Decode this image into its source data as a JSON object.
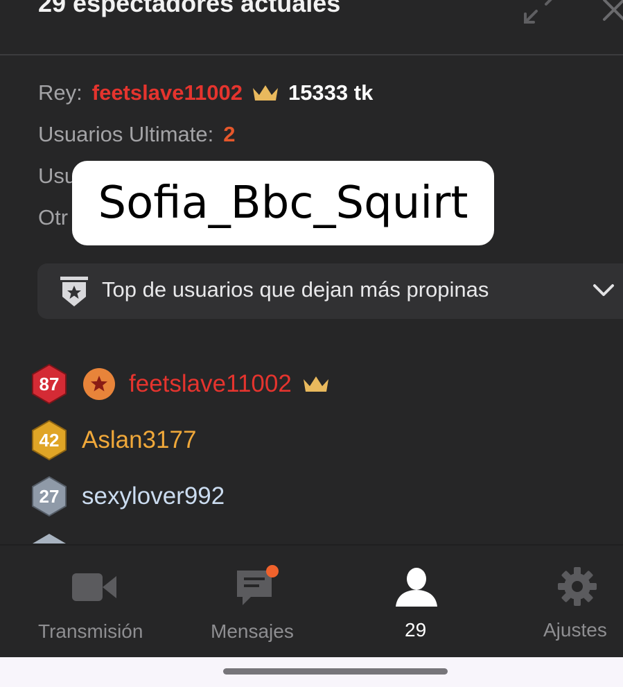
{
  "header": {
    "title": "29 espectadores actuales",
    "expand_icon": "expand-icon",
    "close_icon": "close-icon"
  },
  "info": {
    "king_label": "Rey:",
    "king_name": "feetslave11002",
    "king_tokens": "15333 tk",
    "ultimate_label": "Usuarios Ultimate:",
    "ultimate_count": "2",
    "partial_line3": "Usu",
    "partial_line4": "Otr"
  },
  "overlay": {
    "text": "Sofia_Bbc_Squirt"
  },
  "top_tippers": {
    "label": "Top de usuarios que dejan más propinas",
    "icon": "shield-star-icon",
    "chevron": "chevron-down-icon"
  },
  "users": [
    {
      "level": "87",
      "name": "feetslave11002",
      "name_color": "#e5342e",
      "badge_color": "#d42b35",
      "has_star": true,
      "has_crown": true
    },
    {
      "level": "42",
      "name": "Aslan3177",
      "name_color": "#f0a83a",
      "badge_color": "#e0a526",
      "has_star": false,
      "has_crown": false
    },
    {
      "level": "27",
      "name": "sexylover992",
      "name_color": "#cbdcf0",
      "badge_color": "#8f9aa8",
      "has_star": false,
      "has_crown": false
    }
  ],
  "bottom_nav": {
    "items": [
      {
        "label": "Transmisión",
        "icon": "video-camera-icon"
      },
      {
        "label": "Mensajes",
        "icon": "chat-icon"
      },
      {
        "label": "29",
        "icon": "user-icon"
      },
      {
        "label": "Ajustes",
        "icon": "gear-icon"
      }
    ]
  },
  "colors": {
    "background": "#262627",
    "accent_red": "#e5342e",
    "notification_dot": "#f0622c",
    "crown_gold": "#e9b95d"
  }
}
